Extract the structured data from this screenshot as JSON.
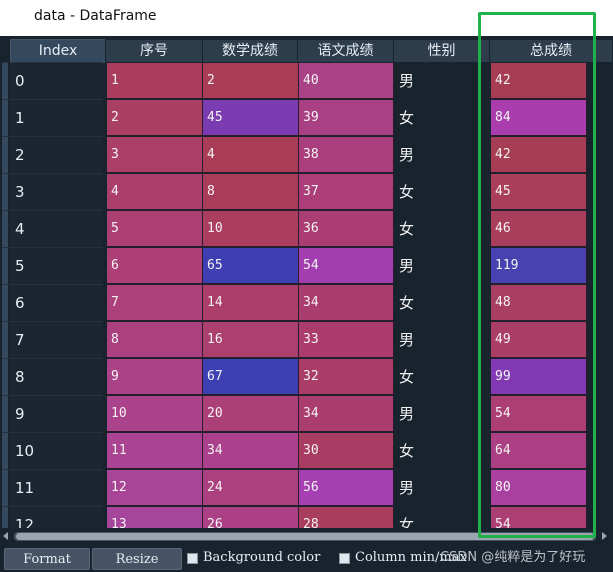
{
  "window": {
    "title": "data - DataFrame"
  },
  "table": {
    "index_header": "Index",
    "columns": [
      "序号",
      "数学成绩",
      "语文成绩",
      "性别",
      "总成绩"
    ],
    "rows": [
      {
        "index": "0",
        "cells": [
          "1",
          "2",
          "40",
          "男",
          "42"
        ]
      },
      {
        "index": "1",
        "cells": [
          "2",
          "45",
          "39",
          "女",
          "84"
        ]
      },
      {
        "index": "2",
        "cells": [
          "3",
          "4",
          "38",
          "男",
          "42"
        ]
      },
      {
        "index": "3",
        "cells": [
          "4",
          "8",
          "37",
          "女",
          "45"
        ]
      },
      {
        "index": "4",
        "cells": [
          "5",
          "10",
          "36",
          "女",
          "46"
        ]
      },
      {
        "index": "5",
        "cells": [
          "6",
          "65",
          "54",
          "男",
          "119"
        ]
      },
      {
        "index": "6",
        "cells": [
          "7",
          "14",
          "34",
          "女",
          "48"
        ]
      },
      {
        "index": "7",
        "cells": [
          "8",
          "16",
          "33",
          "男",
          "49"
        ]
      },
      {
        "index": "8",
        "cells": [
          "9",
          "67",
          "32",
          "女",
          "99"
        ]
      },
      {
        "index": "9",
        "cells": [
          "10",
          "20",
          "34",
          "男",
          "54"
        ]
      },
      {
        "index": "10",
        "cells": [
          "11",
          "34",
          "30",
          "女",
          "64"
        ]
      },
      {
        "index": "11",
        "cells": [
          "12",
          "24",
          "56",
          "男",
          "80"
        ]
      },
      {
        "index": "12",
        "cells": [
          "13",
          "26",
          "28",
          "女",
          "54"
        ]
      }
    ],
    "cell_colors": [
      [
        "#aa3d5d",
        "#a93d57",
        "#aa4287",
        null,
        "#a63d55"
      ],
      [
        "#aa3f64",
        "#7a3cb0",
        "#aa4084",
        null,
        "#a93dad"
      ],
      [
        "#ab3f67",
        "#a93d57",
        "#aa3e7d",
        null,
        "#a63d55"
      ],
      [
        "#ab3f6c",
        "#aa3c5b",
        "#ab3e79",
        null,
        "#a83e5a"
      ],
      [
        "#ab3f71",
        "#ab3e60",
        "#aa3d74",
        null,
        "#a83e5c"
      ],
      [
        "#ab3f76",
        "#3d3fb2",
        "#a23eb0",
        null,
        "#4741b1"
      ],
      [
        "#ab407b",
        "#ab3f6a",
        "#aa3c6e",
        null,
        "#a93e63"
      ],
      [
        "#ab4080",
        "#ab3f6e",
        "#ab3c6c",
        null,
        "#aa3e66"
      ],
      [
        "#ab4186",
        "#3c40b3",
        "#aa3c68",
        null,
        "#8339b3"
      ],
      [
        "#ab428c",
        "#ab4078",
        "#aa3c6e",
        null,
        "#ab3e72"
      ],
      [
        "#aa4391",
        "#ab418d",
        "#a93c63",
        null,
        "#ab3f83"
      ],
      [
        "#a94496",
        "#ab407f",
        "#a53fb2",
        null,
        "#aa40a0"
      ],
      [
        "#a5459c",
        "#ab4184",
        "#a93d5e",
        null,
        "#ab3e72"
      ]
    ]
  },
  "bottom_bar": {
    "format_label": "Format",
    "resize_label": "Resize",
    "bg_color_label": "Background color",
    "col_minmax_label": "Column min/max"
  },
  "watermark": "CSDN @纯粹是为了好玩",
  "colors": {
    "highlight": "#21b14a",
    "background": "#19232d",
    "header": "#2d3d4c"
  }
}
